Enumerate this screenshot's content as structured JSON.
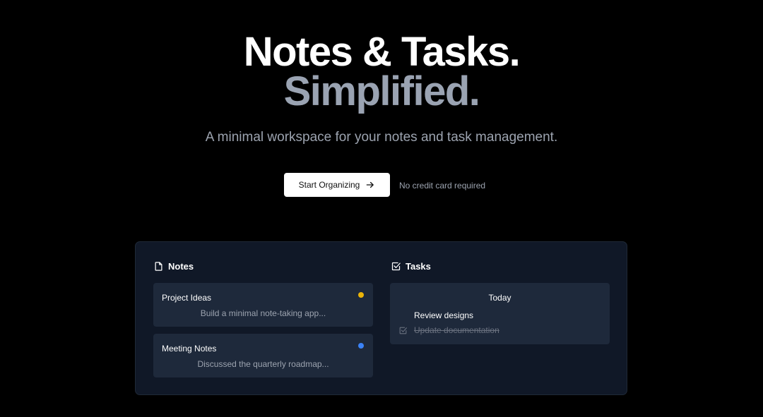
{
  "hero": {
    "title_line1": "Notes & Tasks.",
    "title_line2": "Simplified.",
    "subtitle": "A minimal workspace for your notes and task management."
  },
  "cta": {
    "label": "Start Organizing",
    "icon": "arrow-right-icon",
    "note": "No credit card required"
  },
  "preview": {
    "notes": {
      "heading": "Notes",
      "icon": "file-icon",
      "items": [
        {
          "title": "Project Ideas",
          "body": "Build a minimal note-taking app...",
          "dot_color": "#eab308"
        },
        {
          "title": "Meeting Notes",
          "body": "Discussed the quarterly roadmap...",
          "dot_color": "#3b82f6"
        }
      ]
    },
    "tasks": {
      "heading": "Tasks",
      "icon": "checkbox-icon",
      "group": "Today",
      "items": [
        {
          "label": "Review designs",
          "done": false
        },
        {
          "label": "Update documentation",
          "done": true
        }
      ]
    }
  },
  "colors": {
    "background": "#000000",
    "panel": "#101827",
    "card": "#1e293b",
    "muted_text": "#9ca3af",
    "accent_gray": "#9aa3b2"
  }
}
